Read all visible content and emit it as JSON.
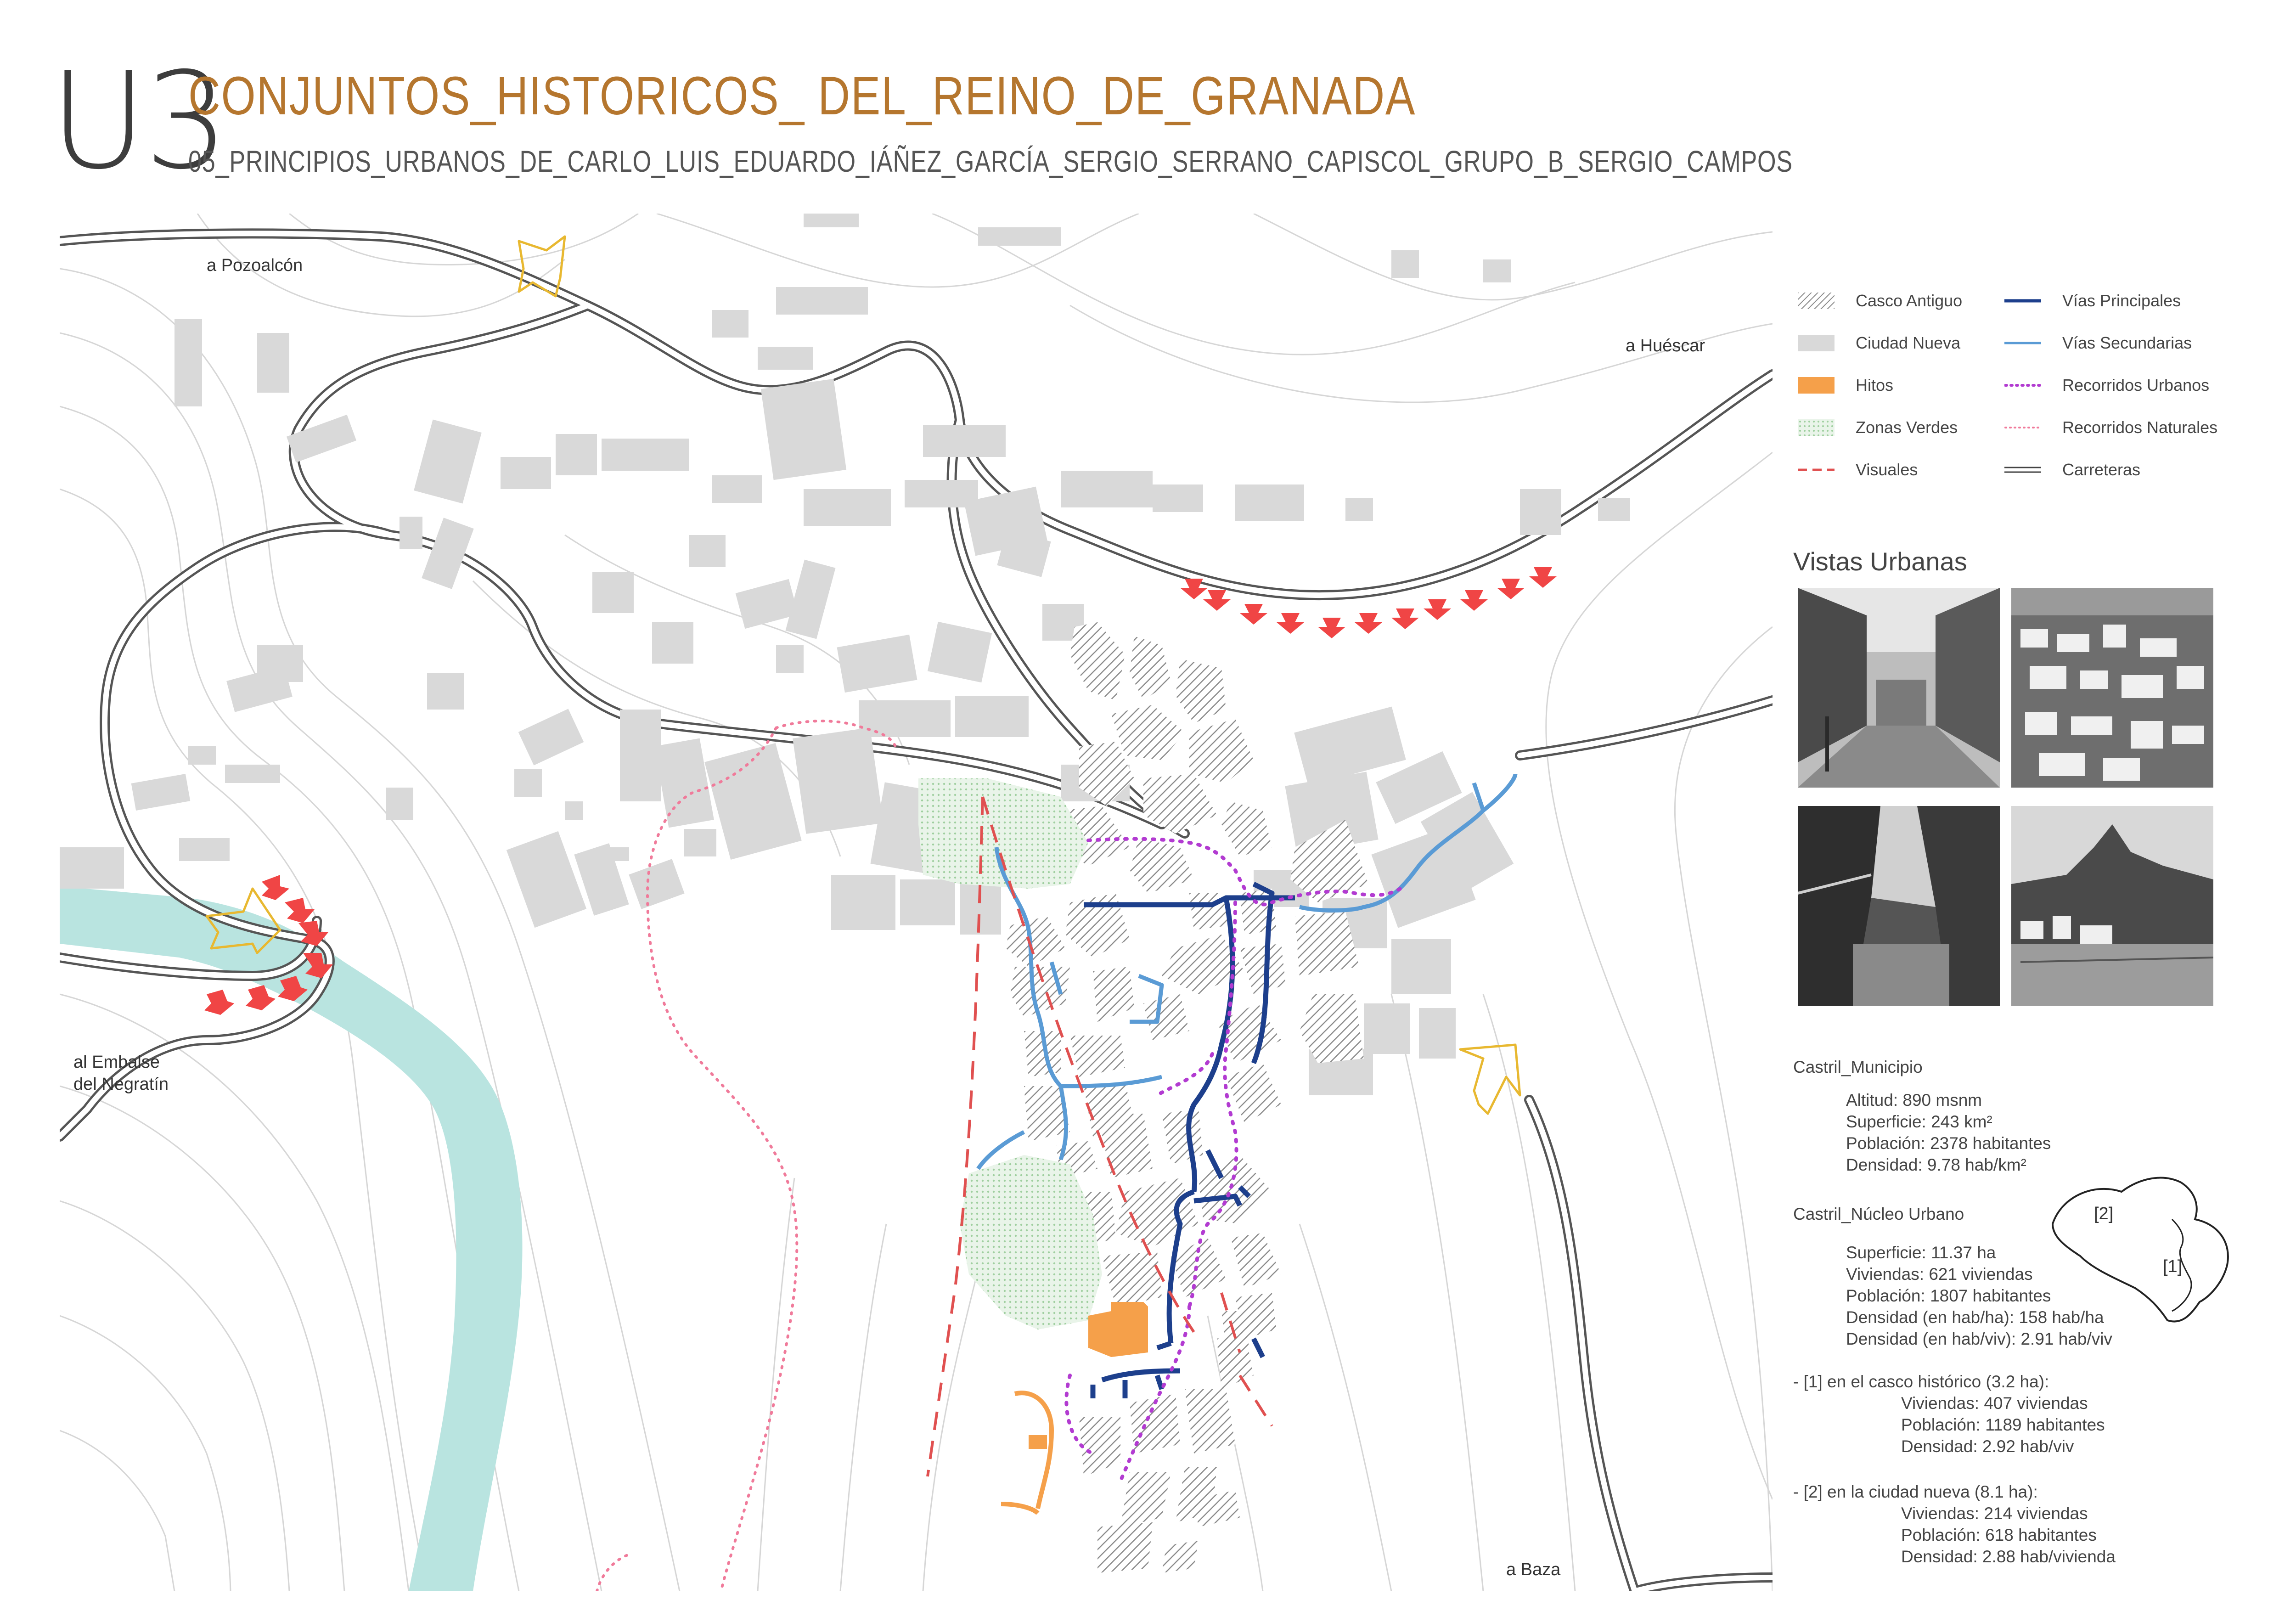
{
  "header": {
    "code": "U3",
    "title": "CONJUNTOS_HISTORICOS_ DEL_REINO_DE_GRANADA",
    "subtitle": "05_PRINCIPIOS_URBANOS_DE_CARLO_LUIS_EDUARDO_IÁÑEZ_GARCÍA_SERGIO_SERRANO_CAPISCOL_GRUPO_B_SERGIO_CAMPOS"
  },
  "map": {
    "labels": {
      "pozoalcon": "a Pozoalcón",
      "huescar": "a Huéscar",
      "embalse_1": "al Embalse",
      "embalse_2": "del Negratín",
      "baza": "a Baza"
    }
  },
  "legend": {
    "items": [
      {
        "label": "Casco Antiguo",
        "color": "#9a9a9a"
      },
      {
        "label": "Ciudad Nueva",
        "color": "#d9d9d9"
      },
      {
        "label": "Hitos",
        "color": "#f5a04a"
      },
      {
        "label": "Zonas Verdes",
        "color": "#b8dcb8"
      },
      {
        "label": "Visuales",
        "color": "#e05050"
      },
      {
        "label": "Vías Principales",
        "color": "#1d3f8c"
      },
      {
        "label": "Vías Secundarias",
        "color": "#5a9bd5"
      },
      {
        "label": "Recorridos Urbanos",
        "color": "#b23bd1"
      },
      {
        "label": "Recorridos Naturales",
        "color": "#f07a9a"
      },
      {
        "label": "Carreteras",
        "color": "#444444"
      }
    ]
  },
  "vistas": {
    "title": "Vistas Urbanas"
  },
  "municipio": {
    "heading": "Castril_Municipio",
    "altitud": "Altitud: 890 msnm",
    "superficie": "Superficie: 243 km²",
    "poblacion": "Población: 2378 habitantes",
    "densidad": "Densidad: 9.78 hab/km²"
  },
  "nucleo": {
    "heading": "Castril_Núcleo Urbano",
    "superficie": "Superficie: 11.37 ha",
    "viviendas": "Viviendas: 621 viviendas",
    "poblacion": "Población: 1807 habitantes",
    "densidad_ha": "Densidad (en hab/ha): 158 hab/ha",
    "densidad_viv": "Densidad (en hab/viv): 2.91 hab/viv"
  },
  "casco": {
    "heading": "- [1] en el casco histórico (3.2 ha):",
    "viviendas": "Viviendas: 407 viviendas",
    "poblacion": "Población: 1189 habitantes",
    "densidad": "Densidad:  2.92 hab/viv"
  },
  "nueva": {
    "heading": "-  [2] en la ciudad nueva (8.1 ha):",
    "viviendas": "Viviendas: 214 viviendas",
    "poblacion": "Población: 618 habitantes",
    "densidad": "Densidad: 2.88 hab/vivienda"
  },
  "inset": {
    "label_2": "[2]",
    "label_1": "[1]"
  }
}
